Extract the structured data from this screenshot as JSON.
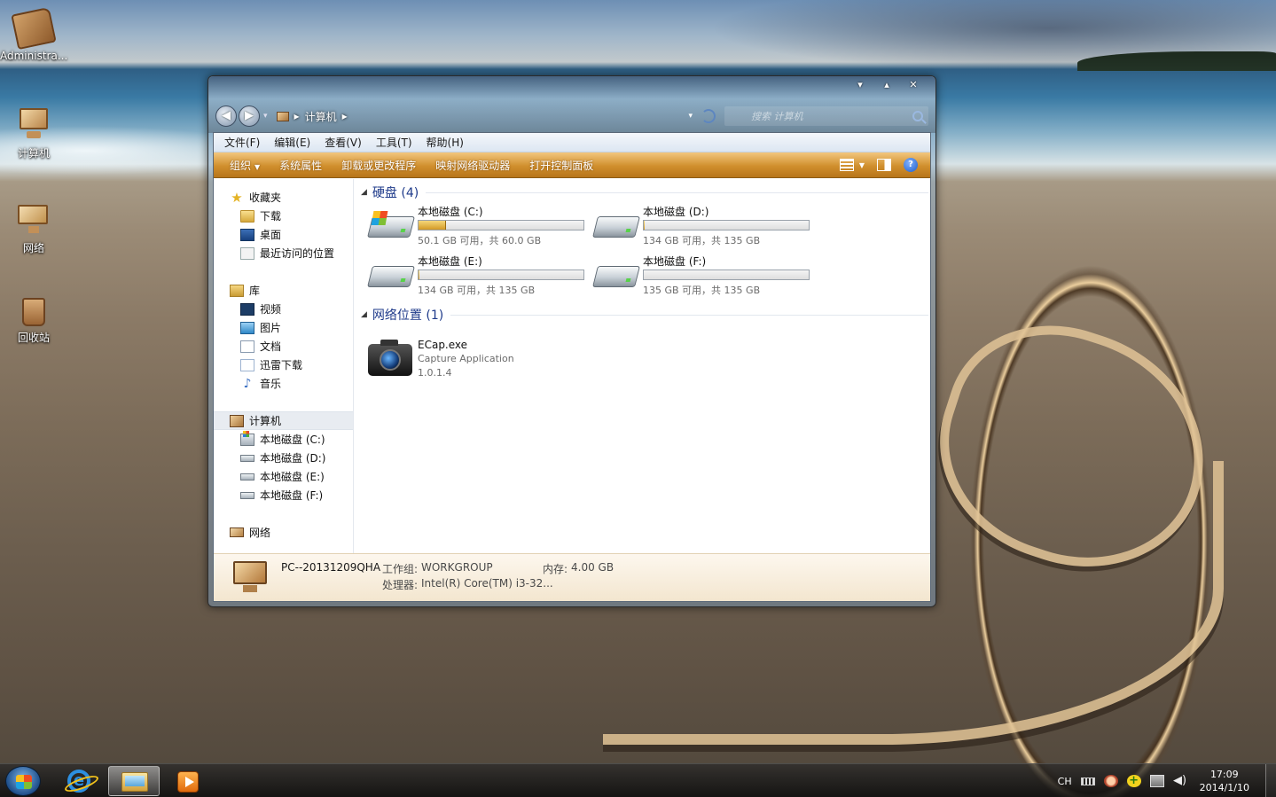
{
  "desktop": {
    "icons": [
      {
        "label": "Administra...",
        "icon": "user-documents-icon"
      },
      {
        "label": "计算机",
        "icon": "computer-icon"
      },
      {
        "label": "网络",
        "icon": "network-icon"
      },
      {
        "label": "回收站",
        "icon": "recycle-bin-icon"
      }
    ]
  },
  "window": {
    "caption_buttons": {
      "minimize": "▾",
      "maximize": "▴",
      "close": "✕"
    },
    "address": {
      "location": "计算机",
      "separator": "▸"
    },
    "search": {
      "placeholder": "搜索 计算机"
    },
    "menu": [
      "文件(F)",
      "编辑(E)",
      "查看(V)",
      "工具(T)",
      "帮助(H)"
    ],
    "commands": {
      "organize": "组织",
      "items": [
        "系统属性",
        "卸载或更改程序",
        "映射网络驱动器",
        "打开控制面板"
      ]
    },
    "navpane": {
      "favorites": {
        "label": "收藏夹",
        "items": [
          "下载",
          "桌面",
          "最近访问的位置"
        ]
      },
      "libraries": {
        "label": "库",
        "items": [
          "视频",
          "图片",
          "文档",
          "迅雷下载",
          "音乐"
        ]
      },
      "computer": {
        "label": "计算机",
        "items": [
          "本地磁盘 (C:)",
          "本地磁盘 (D:)",
          "本地磁盘 (E:)",
          "本地磁盘 (F:)"
        ]
      },
      "network": {
        "label": "网络"
      }
    },
    "groups": {
      "hard_disks": "硬盘 (4)",
      "network_locations": "网络位置 (1)"
    },
    "drives": [
      {
        "name": "本地磁盘 (C:)",
        "free": "50.1 GB 可用，共 60.0 GB",
        "used_fraction": 0.165,
        "system": true
      },
      {
        "name": "本地磁盘 (D:)",
        "free": "134 GB 可用，共 135 GB",
        "used_fraction": 0.007,
        "system": false
      },
      {
        "name": "本地磁盘 (E:)",
        "free": "134 GB 可用，共 135 GB",
        "used_fraction": 0.007,
        "system": false
      },
      {
        "name": "本地磁盘 (F:)",
        "free": "135 GB 可用，共 135 GB",
        "used_fraction": 0.0,
        "system": false
      }
    ],
    "network_item": {
      "name": "ECap.exe",
      "description": "Capture Application",
      "version": "1.0.1.4"
    },
    "details": {
      "computer_name": "PC--20131209QHA",
      "workgroup_label": "工作组:",
      "workgroup": "WORKGROUP",
      "memory_label": "内存:",
      "memory": "4.00 GB",
      "processor_label": "处理器:",
      "processor": "Intel(R) Core(TM) i3-32..."
    }
  },
  "taskbar": {
    "tray": {
      "language": "CH",
      "time": "17:09",
      "date": "2014/1/10"
    }
  }
}
